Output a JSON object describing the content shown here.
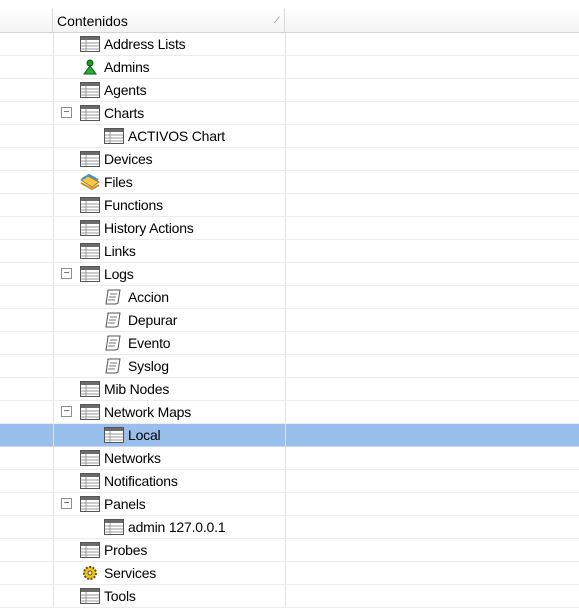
{
  "header": {
    "column_title": "Contenidos"
  },
  "tree": {
    "items": [
      {
        "label": "Address Lists",
        "icon": "table-icon",
        "level": 1
      },
      {
        "label": "Admins",
        "icon": "admin-user-icon",
        "level": 1
      },
      {
        "label": "Agents",
        "icon": "table-icon",
        "level": 1
      },
      {
        "label": "Charts",
        "icon": "table-icon",
        "level": 1,
        "expanded": true
      },
      {
        "label": "ACTIVOS Chart",
        "icon": "table-icon",
        "level": 2
      },
      {
        "label": "Devices",
        "icon": "table-icon",
        "level": 1
      },
      {
        "label": "Files",
        "icon": "files-icon",
        "level": 1
      },
      {
        "label": "Functions",
        "icon": "table-icon",
        "level": 1
      },
      {
        "label": "History Actions",
        "icon": "table-icon",
        "level": 1
      },
      {
        "label": "Links",
        "icon": "table-icon",
        "level": 1
      },
      {
        "label": "Logs",
        "icon": "table-icon",
        "level": 1,
        "expanded": true
      },
      {
        "label": "Accion",
        "icon": "log-scroll-icon",
        "level": 2
      },
      {
        "label": "Depurar",
        "icon": "log-scroll-icon",
        "level": 2
      },
      {
        "label": "Evento",
        "icon": "log-scroll-icon",
        "level": 2
      },
      {
        "label": "Syslog",
        "icon": "log-scroll-icon",
        "level": 2
      },
      {
        "label": "Mib Nodes",
        "icon": "table-icon",
        "level": 1
      },
      {
        "label": "Network Maps",
        "icon": "table-icon",
        "level": 1,
        "expanded": true
      },
      {
        "label": "Local",
        "icon": "table-icon",
        "level": 2,
        "selected": true
      },
      {
        "label": "Networks",
        "icon": "table-icon",
        "level": 1
      },
      {
        "label": "Notifications",
        "icon": "table-icon",
        "level": 1
      },
      {
        "label": "Panels",
        "icon": "table-icon",
        "level": 1,
        "expanded": true
      },
      {
        "label": "admin 127.0.0.1",
        "icon": "table-icon",
        "level": 2
      },
      {
        "label": "Probes",
        "icon": "table-icon",
        "level": 1
      },
      {
        "label": "Services",
        "icon": "gear-services-icon",
        "level": 1
      },
      {
        "label": "Tools",
        "icon": "table-icon",
        "level": 1
      }
    ]
  },
  "colors": {
    "selection": "#99c0ec",
    "grid_line": "#ececec"
  }
}
